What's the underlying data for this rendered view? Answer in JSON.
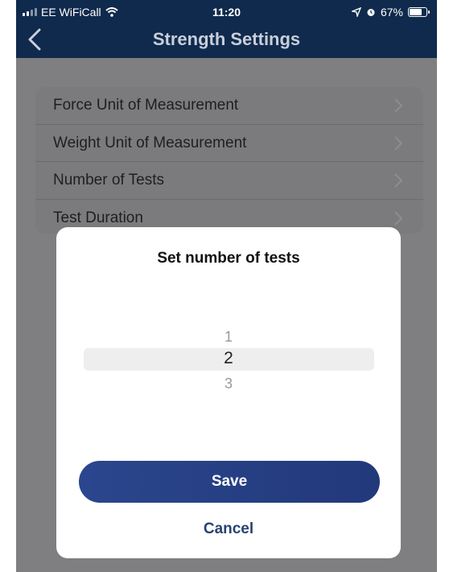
{
  "status_bar": {
    "carrier": "EE WiFiCall",
    "time": "11:20",
    "battery": "67%",
    "battery_level": 0.67,
    "icons": [
      "signal-bars-icon",
      "wifi-icon",
      "location-arrow-icon",
      "alarm-icon",
      "battery-icon"
    ]
  },
  "header": {
    "title": "Strength Settings",
    "back_icon": "chevron-left-icon",
    "background": "#0f2a4c"
  },
  "settings_list": {
    "items": [
      {
        "label": "Force Unit of Measurement",
        "icon": "chevron-right-icon"
      },
      {
        "label": "Weight Unit of Measurement",
        "icon": "chevron-right-icon"
      },
      {
        "label": "Number of Tests",
        "icon": "chevron-right-icon"
      },
      {
        "label": "Test Duration",
        "icon": "chevron-right-icon"
      }
    ]
  },
  "dialog": {
    "title": "Set number of tests",
    "picker": {
      "options": [
        "1",
        "2",
        "3"
      ],
      "selected": "2"
    },
    "save_label": "Save",
    "cancel_label": "Cancel",
    "accent": "#2b468e"
  }
}
